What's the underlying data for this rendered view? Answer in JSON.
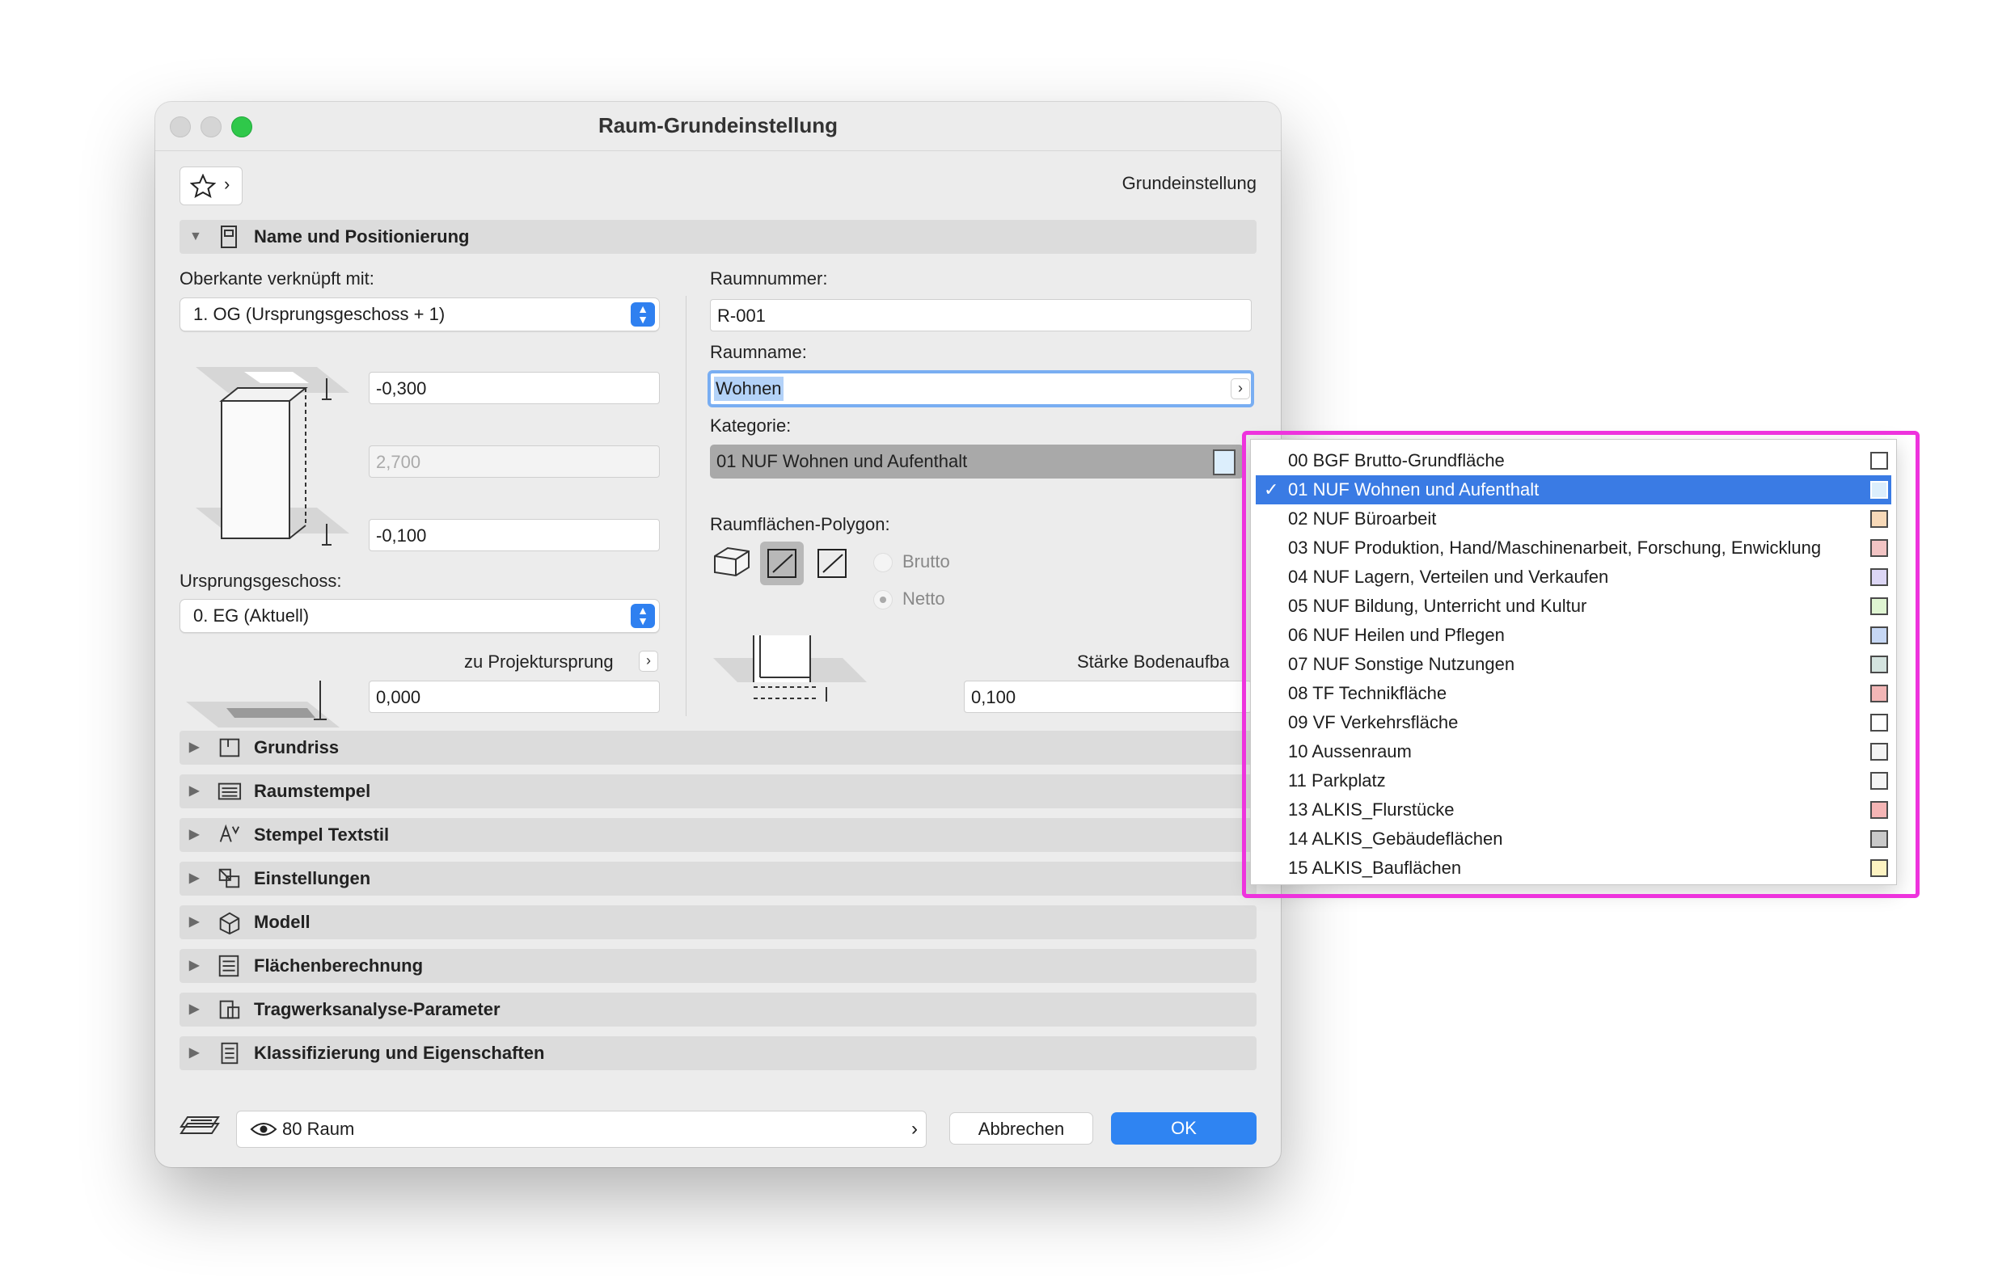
{
  "window": {
    "title": "Raum-Grundeinstellung",
    "preset_label": "Grundeinstellung"
  },
  "name_section": {
    "title": "Name und Positionierung",
    "top_linked_label": "Oberkante verknüpft mit:",
    "top_linked_value": "1. OG (Ursprungsgeschoss + 1)",
    "top_offset": "-0,300",
    "height": "2,700",
    "bottom_offset": "-0,100",
    "home_story_label": "Ursprungsgeschoss:",
    "home_story_value": "0. EG (Aktuell)",
    "to_project_zero_label": "zu Projekturspr‌ung",
    "project_zero_value": "0,000",
    "room_number_label": "Raumnummer:",
    "room_number_value": "R-001",
    "room_name_label": "Raumname:",
    "room_name_value": "Wohnen",
    "category_label": "Kategorie:",
    "category_value": "01 NUF Wohnen und Aufenthalt",
    "polygon_label": "Raumflächen-Polygon:",
    "gross_label": "Brutto",
    "net_label": "Netto",
    "floor_thickness_label": "Stärke Bodenaufba",
    "floor_thickness_value": "0,100"
  },
  "sections": [
    {
      "title": "Grundriss",
      "icon": "floor-plan-icon"
    },
    {
      "title": "Raumstempel",
      "icon": "zone-stamp-icon"
    },
    {
      "title": "Stempel Textstil",
      "icon": "text-style-icon"
    },
    {
      "title": "Einstellungen",
      "icon": "settings-icon"
    },
    {
      "title": "Modell",
      "icon": "model-icon"
    },
    {
      "title": "Flächenberechnung",
      "icon": "area-calc-icon"
    },
    {
      "title": "Tragwerksanalyse-Parameter",
      "icon": "structural-icon"
    },
    {
      "title": "Klassifizierung und Eigenschaften",
      "icon": "classification-icon"
    }
  ],
  "footer": {
    "layer_value": "80 Raum",
    "cancel_label": "Abbrechen",
    "ok_label": "OK"
  },
  "menu": {
    "selected_index": 1,
    "items": [
      {
        "label": "00 BGF Brutto-Grundfläche",
        "color": "#ffffff"
      },
      {
        "label": "01 NUF Wohnen und Aufenthalt",
        "color": "#dceefc"
      },
      {
        "label": "02 NUF Büroarbeit",
        "color": "#f7d9b8"
      },
      {
        "label": "03 NUF Produktion, Hand/Maschinenarbeit, Forschung, Enwicklung",
        "color": "#f2c4c4"
      },
      {
        "label": "04 NUF Lagern, Verteilen und Verkaufen",
        "color": "#dcd6f5"
      },
      {
        "label": "05 NUF Bildung, Unterricht und Kultur",
        "color": "#dff5d2"
      },
      {
        "label": "06 NUF Heilen und Pflegen",
        "color": "#c6d7f4"
      },
      {
        "label": "07 NUF Sonstige Nutzungen",
        "color": "#d4e3df"
      },
      {
        "label": "08 TF Technikfläche",
        "color": "#f2b6b6"
      },
      {
        "label": "09 VF Verkehrsfläche",
        "color": "#ffffff"
      },
      {
        "label": "10 Aussenraum",
        "color": "#f4f4f4"
      },
      {
        "label": "11 Parkplatz",
        "color": "#f4f4f4"
      },
      {
        "label": "13 ALKIS_Flurstücke",
        "color": "#f5b5b5"
      },
      {
        "label": "14 ALKIS_Gebäudeflächen",
        "color": "#c9c9c9"
      },
      {
        "label": "15 ALKIS_Bauflächen",
        "color": "#fdf3c2"
      }
    ]
  }
}
